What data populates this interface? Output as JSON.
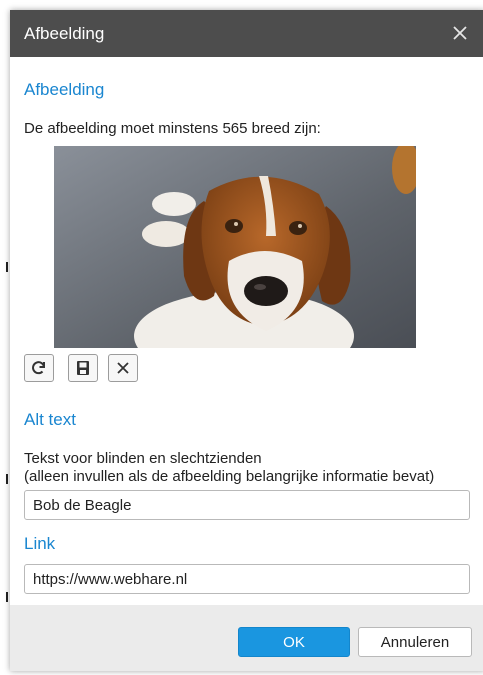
{
  "dialog": {
    "title": "Afbeelding",
    "close_icon": "close-icon"
  },
  "image_section": {
    "heading": "Afbeelding",
    "requirement": "De afbeelding moet minstens 565 breed zijn:",
    "tools": [
      {
        "name": "refresh-icon"
      },
      {
        "name": "save-icon"
      },
      {
        "name": "delete-icon"
      }
    ]
  },
  "alt_section": {
    "heading": "Alt text",
    "description_line1": "Tekst voor blinden en slechtzienden",
    "description_line2": "(alleen invullen als de afbeelding belangrijke informatie bevat)",
    "value": "Bob de Beagle"
  },
  "link_section": {
    "heading": "Link",
    "value": "https://www.webhare.nl"
  },
  "footer": {
    "ok_label": "OK",
    "cancel_label": "Annuleren"
  },
  "colors": {
    "accent": "#1a86d0",
    "titlebar": "#4d4d4d",
    "ok_button": "#1a96e0",
    "footer_bg": "#ebebeb"
  }
}
